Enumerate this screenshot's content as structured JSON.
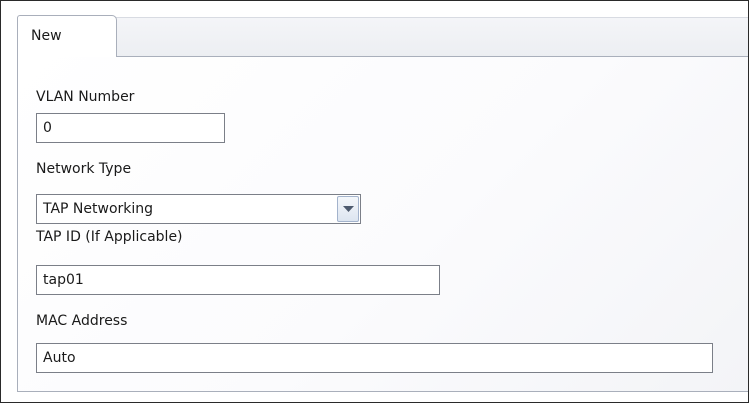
{
  "tabs": [
    {
      "label": "New",
      "active": true
    }
  ],
  "form": {
    "vlan_number": {
      "label": "VLAN Number",
      "value": "0"
    },
    "network_type": {
      "label": "Network Type",
      "value": "TAP Networking",
      "icon": "chevron-down-icon"
    },
    "tap_id": {
      "label": "TAP ID (If Applicable)",
      "value": "tap01"
    },
    "mac_address": {
      "label": "MAC Address",
      "value": "Auto"
    }
  },
  "colors": {
    "border": "#7b7f88",
    "tab_border": "#a9afbb",
    "dropdown_button": "#dde5f0"
  }
}
